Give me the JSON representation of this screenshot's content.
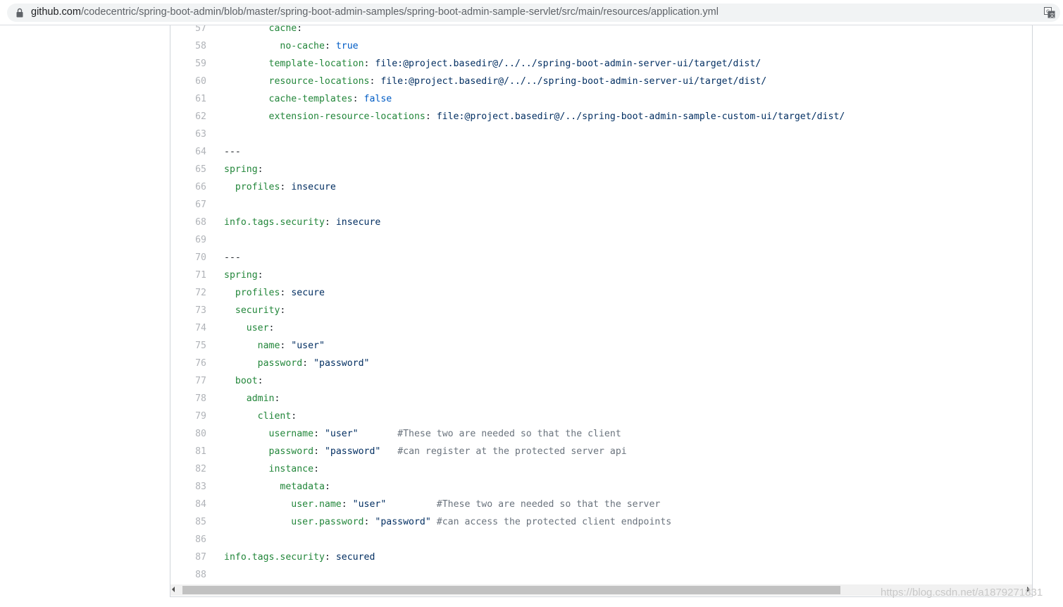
{
  "browser": {
    "url_host": "github.com",
    "url_path": "/codecentric/spring-boot-admin/blob/master/spring-boot-admin-samples/spring-boot-admin-sample-servlet/src/main/resources/application.yml",
    "icons": {
      "lock": "lock-icon",
      "translate": "translate-icon"
    }
  },
  "code": {
    "lines": [
      {
        "n": "57",
        "tokens": [
          {
            "t": "        "
          },
          {
            "t": "cache",
            "c": "k"
          },
          {
            "t": ":"
          }
        ]
      },
      {
        "n": "58",
        "tokens": [
          {
            "t": "          "
          },
          {
            "t": "no-cache",
            "c": "k"
          },
          {
            "t": ": "
          },
          {
            "t": "true",
            "c": "b"
          }
        ]
      },
      {
        "n": "59",
        "tokens": [
          {
            "t": "        "
          },
          {
            "t": "template-location",
            "c": "k"
          },
          {
            "t": ": "
          },
          {
            "t": "file:@project.basedir@/../../spring-boot-admin-server-ui/target/dist/",
            "c": "s"
          }
        ]
      },
      {
        "n": "60",
        "tokens": [
          {
            "t": "        "
          },
          {
            "t": "resource-locations",
            "c": "k"
          },
          {
            "t": ": "
          },
          {
            "t": "file:@project.basedir@/../../spring-boot-admin-server-ui/target/dist/",
            "c": "s"
          }
        ]
      },
      {
        "n": "61",
        "tokens": [
          {
            "t": "        "
          },
          {
            "t": "cache-templates",
            "c": "k"
          },
          {
            "t": ": "
          },
          {
            "t": "false",
            "c": "b"
          }
        ]
      },
      {
        "n": "62",
        "tokens": [
          {
            "t": "        "
          },
          {
            "t": "extension-resource-locations",
            "c": "k"
          },
          {
            "t": ": "
          },
          {
            "t": "file:@project.basedir@/../spring-boot-admin-sample-custom-ui/target/dist/",
            "c": "s"
          }
        ]
      },
      {
        "n": "63",
        "tokens": []
      },
      {
        "n": "64",
        "tokens": [
          {
            "t": "---"
          }
        ]
      },
      {
        "n": "65",
        "tokens": [
          {
            "t": "spring",
            "c": "k"
          },
          {
            "t": ":"
          }
        ]
      },
      {
        "n": "66",
        "tokens": [
          {
            "t": "  "
          },
          {
            "t": "profiles",
            "c": "k"
          },
          {
            "t": ": "
          },
          {
            "t": "insecure",
            "c": "s"
          }
        ]
      },
      {
        "n": "67",
        "tokens": []
      },
      {
        "n": "68",
        "tokens": [
          {
            "t": "info.tags.security",
            "c": "k"
          },
          {
            "t": ": "
          },
          {
            "t": "insecure",
            "c": "s"
          }
        ]
      },
      {
        "n": "69",
        "tokens": []
      },
      {
        "n": "70",
        "tokens": [
          {
            "t": "---"
          }
        ]
      },
      {
        "n": "71",
        "tokens": [
          {
            "t": "spring",
            "c": "k"
          },
          {
            "t": ":"
          }
        ]
      },
      {
        "n": "72",
        "tokens": [
          {
            "t": "  "
          },
          {
            "t": "profiles",
            "c": "k"
          },
          {
            "t": ": "
          },
          {
            "t": "secure",
            "c": "s"
          }
        ]
      },
      {
        "n": "73",
        "tokens": [
          {
            "t": "  "
          },
          {
            "t": "security",
            "c": "k"
          },
          {
            "t": ":"
          }
        ]
      },
      {
        "n": "74",
        "tokens": [
          {
            "t": "    "
          },
          {
            "t": "user",
            "c": "k"
          },
          {
            "t": ":"
          }
        ]
      },
      {
        "n": "75",
        "tokens": [
          {
            "t": "      "
          },
          {
            "t": "name",
            "c": "k"
          },
          {
            "t": ": "
          },
          {
            "t": "\"user\"",
            "c": "s"
          }
        ]
      },
      {
        "n": "76",
        "tokens": [
          {
            "t": "      "
          },
          {
            "t": "password",
            "c": "k"
          },
          {
            "t": ": "
          },
          {
            "t": "\"password\"",
            "c": "s"
          }
        ]
      },
      {
        "n": "77",
        "tokens": [
          {
            "t": "  "
          },
          {
            "t": "boot",
            "c": "k"
          },
          {
            "t": ":"
          }
        ]
      },
      {
        "n": "78",
        "tokens": [
          {
            "t": "    "
          },
          {
            "t": "admin",
            "c": "k"
          },
          {
            "t": ":"
          }
        ]
      },
      {
        "n": "79",
        "tokens": [
          {
            "t": "      "
          },
          {
            "t": "client",
            "c": "k"
          },
          {
            "t": ":"
          }
        ]
      },
      {
        "n": "80",
        "tokens": [
          {
            "t": "        "
          },
          {
            "t": "username",
            "c": "k"
          },
          {
            "t": ": "
          },
          {
            "t": "\"user\"",
            "c": "s"
          },
          {
            "t": "       "
          },
          {
            "t": "#These two are needed so that the client",
            "c": "c"
          }
        ]
      },
      {
        "n": "81",
        "tokens": [
          {
            "t": "        "
          },
          {
            "t": "password",
            "c": "k"
          },
          {
            "t": ": "
          },
          {
            "t": "\"password\"",
            "c": "s"
          },
          {
            "t": "   "
          },
          {
            "t": "#can register at the protected server api",
            "c": "c"
          }
        ]
      },
      {
        "n": "82",
        "tokens": [
          {
            "t": "        "
          },
          {
            "t": "instance",
            "c": "k"
          },
          {
            "t": ":"
          }
        ]
      },
      {
        "n": "83",
        "tokens": [
          {
            "t": "          "
          },
          {
            "t": "metadata",
            "c": "k"
          },
          {
            "t": ":"
          }
        ]
      },
      {
        "n": "84",
        "tokens": [
          {
            "t": "            "
          },
          {
            "t": "user.name",
            "c": "k"
          },
          {
            "t": ": "
          },
          {
            "t": "\"user\"",
            "c": "s"
          },
          {
            "t": "         "
          },
          {
            "t": "#These two are needed so that the server",
            "c": "c"
          }
        ]
      },
      {
        "n": "85",
        "tokens": [
          {
            "t": "            "
          },
          {
            "t": "user.password",
            "c": "k"
          },
          {
            "t": ": "
          },
          {
            "t": "\"password\"",
            "c": "s"
          },
          {
            "t": " "
          },
          {
            "t": "#can access the protected client endpoints",
            "c": "c"
          }
        ]
      },
      {
        "n": "86",
        "tokens": []
      },
      {
        "n": "87",
        "tokens": [
          {
            "t": "info.tags.security",
            "c": "k"
          },
          {
            "t": ": "
          },
          {
            "t": "secured",
            "c": "s"
          }
        ]
      },
      {
        "n": "88",
        "tokens": []
      }
    ]
  },
  "watermark": "https://blog.csdn.net/a1879271831",
  "colors": {
    "key": "#22863a",
    "string": "#032f62",
    "bool": "#005cc5",
    "comment": "#6a737d",
    "line_number": "#b0b3b8"
  }
}
